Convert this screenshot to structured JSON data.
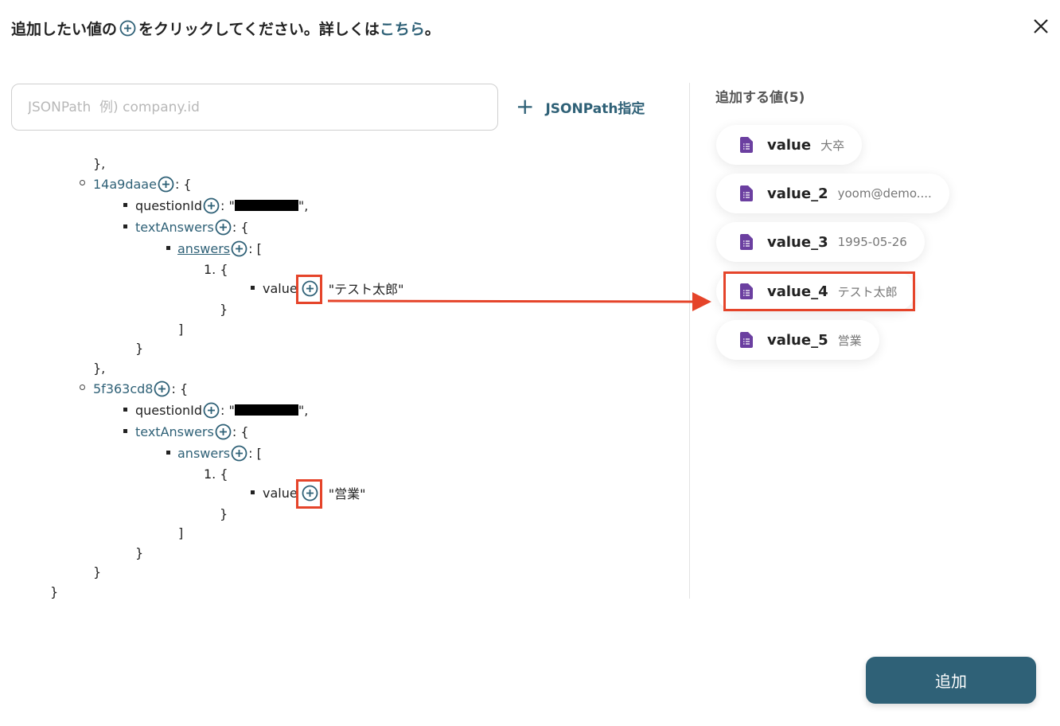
{
  "header": {
    "title_before": "追加したい値の",
    "title_after": "をクリックしてください。詳しくは",
    "link_text": "こちら",
    "title_end": "。"
  },
  "search": {
    "placeholder": "JSONPath  例) company.id",
    "value": ""
  },
  "jsonpath_button": {
    "label": "JSONPath指定"
  },
  "tree": {
    "close_brace_comma": "},",
    "close_brace": "}",
    "close_bracket": "]",
    "open_brace": "{",
    "open_bracket": "[",
    "colon_brace": ": {",
    "colon_bracket": ": [",
    "colon_quote": ": \"",
    "quote_comma": "\",",
    "item_number": "1. {",
    "key1": "14a9daae",
    "key2": "5f363cd8",
    "questionId": "questionId",
    "textAnswers": "textAnswers",
    "answers": "answers",
    "value": "value",
    "value1": "\"テスト太郎\"",
    "value2": "\"営業\""
  },
  "panel": {
    "title": "追加する値(5)",
    "items": [
      {
        "name": "value",
        "value": "大卒"
      },
      {
        "name": "value_2",
        "value": "yoom@demo...."
      },
      {
        "name": "value_3",
        "value": "1995-05-26"
      },
      {
        "name": "value_4",
        "value": "テスト太郎"
      },
      {
        "name": "value_5",
        "value": "営業"
      }
    ]
  },
  "add_button": {
    "label": "追加"
  },
  "colors": {
    "accent": "#2f6177",
    "highlight": "#e5442a",
    "doc_icon": "#6b3fa0"
  }
}
